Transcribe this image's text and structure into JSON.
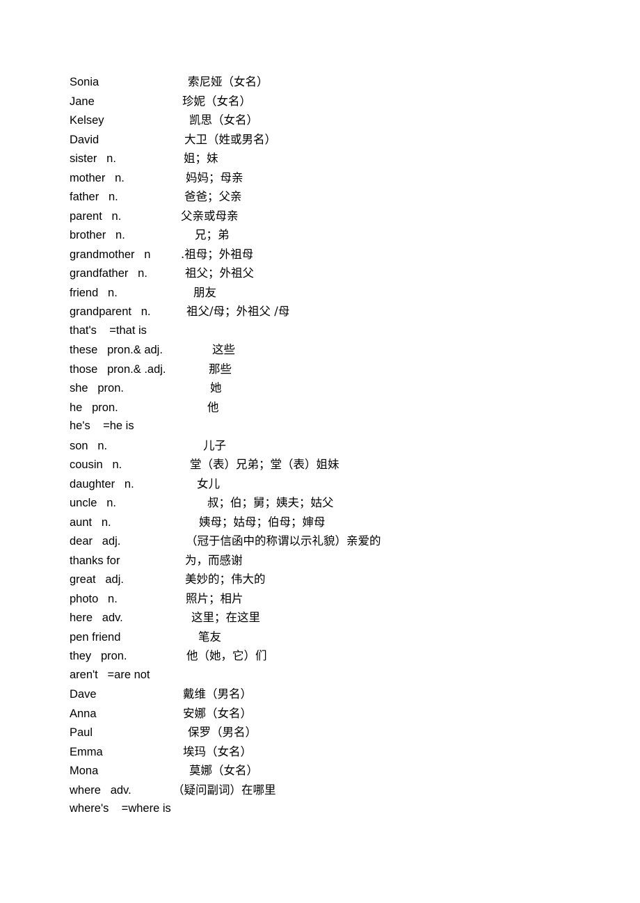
{
  "document": {
    "type": "vocabulary-word-list",
    "language_pair": "English-Chinese",
    "background_color": "#ffffff",
    "text_color": "#000000",
    "entries": [
      {
        "english": "Sonia",
        "english_width": 170,
        "chinese": "索尼娅（女名）"
      },
      {
        "english": "Jane",
        "english_width": 162,
        "chinese": "珍妮（女名）"
      },
      {
        "english": "Kelsey",
        "english_width": 172,
        "chinese": "凯思（女名）"
      },
      {
        "english": "David",
        "english_width": 165,
        "chinese": "大卫（姓或男名）"
      },
      {
        "english": "sister   n.",
        "english_width": 164,
        "chinese": "姐；妹"
      },
      {
        "english": "mother   n.",
        "english_width": 167,
        "chinese": "妈妈；母亲"
      },
      {
        "english": "father   n.",
        "english_width": 165,
        "chinese": "爸爸；父亲"
      },
      {
        "english": "parent   n.",
        "english_width": 160,
        "chinese": "父亲或母亲"
      },
      {
        "english": "brother   n.",
        "english_width": 180,
        "chinese": "兄；弟"
      },
      {
        "english": "grandmother   n",
        "english_width": 160,
        "chinese": ".祖母；外祖母"
      },
      {
        "english": "grandfather   n.",
        "english_width": 166,
        "chinese": "祖父；外祖父"
      },
      {
        "english": "friend   n.",
        "english_width": 178,
        "chinese": "朋友"
      },
      {
        "english": "grandparent   n.",
        "english_width": 168,
        "chinese": "祖父/母；外祖父 /母"
      },
      {
        "english": "that's    =that is",
        "english_width": 0,
        "chinese": ""
      },
      {
        "english": "these   pron.& adj.",
        "english_width": 205,
        "chinese": "这些"
      },
      {
        "english": "those   pron.& .adj.",
        "english_width": 200,
        "chinese": "那些"
      },
      {
        "english": "she   pron.",
        "english_width": 202,
        "chinese": "她"
      },
      {
        "english": "he   pron.",
        "english_width": 198,
        "chinese": "他"
      },
      {
        "english": "he's    =he is",
        "english_width": 0,
        "chinese": ""
      },
      {
        "english": "son   n.",
        "english_width": 192,
        "chinese": "儿子"
      },
      {
        "english": "cousin   n.",
        "english_width": 173,
        "chinese": "堂（表）兄弟；堂（表）姐妹"
      },
      {
        "english": "daughter   n.",
        "english_width": 183,
        "chinese": "女儿"
      },
      {
        "english": "uncle   n.",
        "english_width": 198,
        "chinese": "叔；伯；舅；姨夫；姑父"
      },
      {
        "english": "aunt   n.",
        "english_width": 186,
        "chinese": "姨母；姑母；伯母；婶母"
      },
      {
        "english": "dear   adj.",
        "english_width": 167,
        "chinese": "（冠于信函中的称谓以示礼貌）亲爱的"
      },
      {
        "english": "thanks for",
        "english_width": 166,
        "chinese": "为，而感谢"
      },
      {
        "english": "great   adj.",
        "english_width": 166,
        "chinese": "美妙的；伟大的"
      },
      {
        "english": "photo   n.",
        "english_width": 167,
        "chinese": "照片；相片"
      },
      {
        "english": "here   adv.",
        "english_width": 175,
        "chinese": "这里；在这里"
      },
      {
        "english": "pen friend",
        "english_width": 185,
        "chinese": "笔友"
      },
      {
        "english": "they   pron.",
        "english_width": 168,
        "chinese": "他（她，它）们"
      },
      {
        "english": "aren't   =are not",
        "english_width": 0,
        "chinese": ""
      },
      {
        "english": "Dave",
        "english_width": 163,
        "chinese": "戴维（男名）"
      },
      {
        "english": "Anna",
        "english_width": 163,
        "chinese": "安娜（女名）"
      },
      {
        "english": "Paul",
        "english_width": 170,
        "chinese": "保罗（男名）"
      },
      {
        "english": "Emma",
        "english_width": 163,
        "chinese": "埃玛（女名）"
      },
      {
        "english": "Mona",
        "english_width": 172,
        "chinese": "莫娜（女名）"
      },
      {
        "english": "where   adv.",
        "english_width": 148,
        "chinese": "（疑问副词）在哪里"
      },
      {
        "english": "where's    =where is",
        "english_width": 0,
        "chinese": ""
      }
    ]
  }
}
